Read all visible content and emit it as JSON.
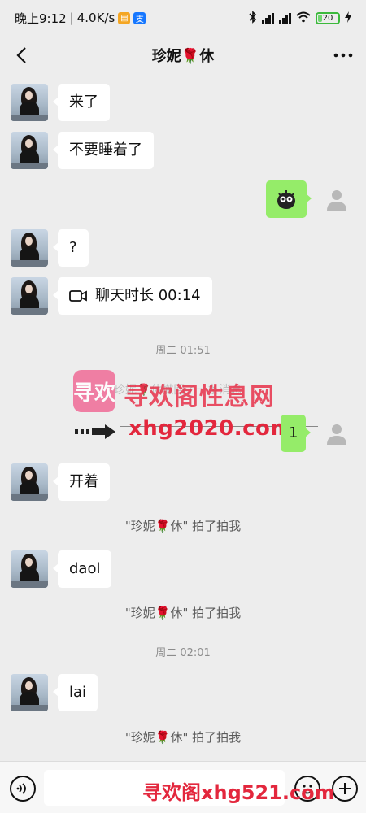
{
  "status_bar": {
    "time": "晚上9:12",
    "speed": "4.0K/s",
    "battery": "20",
    "battery_level": 0.2
  },
  "nav": {
    "title": "珍妮🌹休"
  },
  "messages": [
    {
      "text": "来了"
    },
    {
      "text": "不要睡着了"
    },
    {
      "text": "?"
    },
    {
      "text": "聊天时长 00:14"
    },
    {
      "text": "1"
    },
    {
      "text": "开着"
    },
    {
      "text": "daol"
    },
    {
      "text": "lai"
    }
  ],
  "time_labels": [
    "周二 01:51",
    "周二 02:01"
  ],
  "system_messages": [
    "\"珍妮🌹休\" 拍了拍我",
    "\"珍妮🌹休\" 拍了拍我",
    "\"珍妮🌹休\" 拍了拍我"
  ],
  "watermark": {
    "faded_text": "珍妮🌹休撤回了一条消息",
    "title": "寻欢阁性息网",
    "url": "xhg2020.com",
    "bottom": "寻欢阁xhg521.com",
    "logo": "寻欢"
  },
  "input": {
    "value": ""
  },
  "icons": {
    "back": "back-chevron-icon",
    "more": "more-dots-icon",
    "video": "video-call-icon",
    "voice": "voice-icon",
    "emoji": "emoji-icon",
    "plus": "plus-icon",
    "sticker": "sticker-icon",
    "avatar": "default-avatar-icon"
  },
  "colors": {
    "background": "#ededed",
    "bubble_sent": "#95ec69",
    "bubble_received": "#ffffff"
  }
}
